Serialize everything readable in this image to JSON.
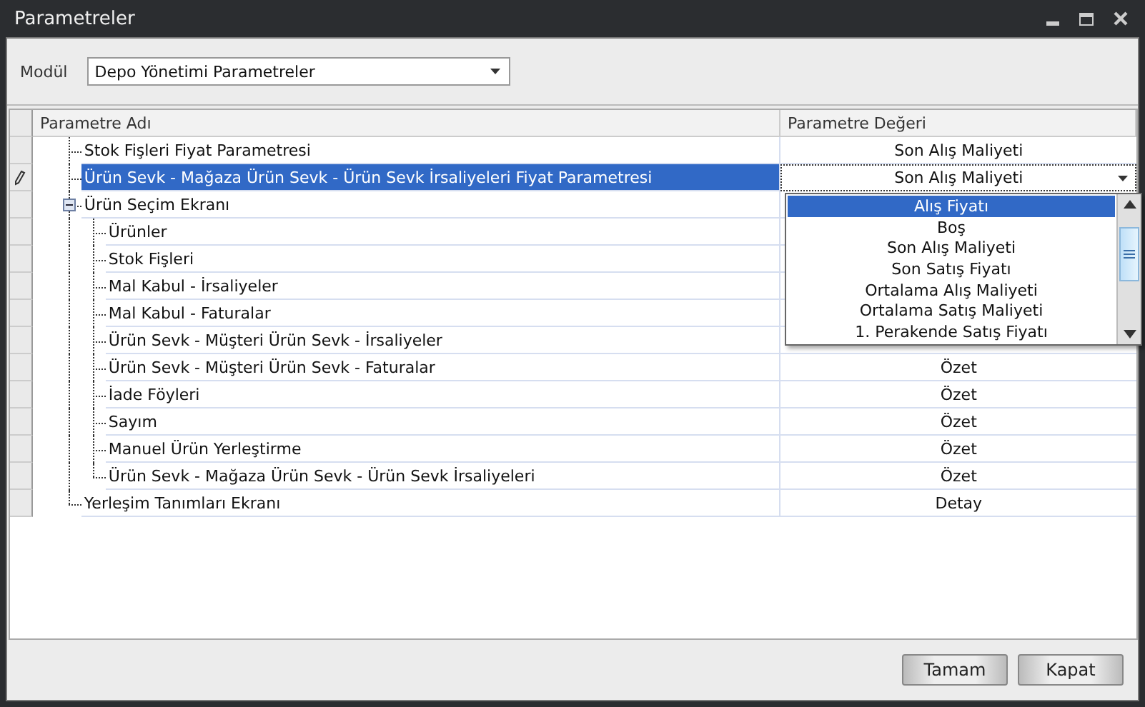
{
  "window": {
    "title": "Parametreler"
  },
  "module": {
    "label": "Modül",
    "value": "Depo Yönetimi Parametreler"
  },
  "table": {
    "columns": [
      "Parametre Adı",
      "Parametre Değeri"
    ],
    "rows": [
      {
        "name": "Stok Fişleri Fiyat Parametresi",
        "value": "Son Alış Maliyeti",
        "selected": false
      },
      {
        "name": "Ürün Sevk - Mağaza Ürün Sevk - Ürün Sevk İrsaliyeleri Fiyat Parametresi",
        "value": "Son Alış Maliyeti",
        "selected": true
      },
      {
        "name": "Ürün Seçim Ekranı",
        "selected": false,
        "expanded": true,
        "children": [
          {
            "name": "Ürünler",
            "selected": false
          },
          {
            "name": "Stok Fişleri",
            "selected": false
          },
          {
            "name": "Mal Kabul - İrsaliyeler",
            "selected": false
          },
          {
            "name": "Mal Kabul - Faturalar",
            "selected": false
          },
          {
            "name": "Ürün Sevk - Müşteri Ürün Sevk - İrsaliyeler",
            "selected": false
          },
          {
            "name": "Ürün Sevk - Müşteri Ürün Sevk - Faturalar",
            "value": "Özet",
            "selected": false
          },
          {
            "name": "İade Föyleri",
            "value": "Özet",
            "selected": false
          },
          {
            "name": "Sayım",
            "value": "Özet",
            "selected": false
          },
          {
            "name": "Manuel Ürün Yerleştirme",
            "value": "Özet",
            "selected": false
          },
          {
            "name": "Ürün Sevk - Mağaza Ürün Sevk - Ürün Sevk İrsaliyeleri",
            "value": "Özet",
            "selected": false
          }
        ]
      },
      {
        "name": "Yerleşim Tanımları Ekranı",
        "value": "Detay",
        "selected": false
      }
    ]
  },
  "dropdown": {
    "options": [
      {
        "label": "Alış Fiyatı",
        "selected": true
      },
      {
        "label": "Boş",
        "selected": false
      },
      {
        "label": "Son Alış Maliyeti",
        "selected": false
      },
      {
        "label": "Son Satış Fiyatı",
        "selected": false
      },
      {
        "label": "Ortalama Alış Maliyeti",
        "selected": false
      },
      {
        "label": "Ortalama Satış Maliyeti",
        "selected": false
      },
      {
        "label": "1. Perakende Satış Fiyatı",
        "selected": false
      }
    ]
  },
  "buttons": [
    "Tamam",
    "Kapat"
  ]
}
